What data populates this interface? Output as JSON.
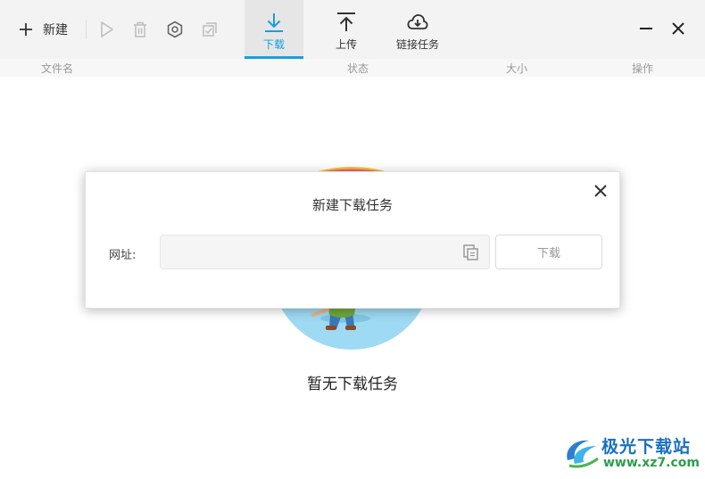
{
  "toolbar": {
    "new_label": "新建",
    "icons": [
      "plus-icon",
      "play-icon",
      "trash-icon",
      "gear-icon",
      "check-square-icon"
    ],
    "tabs": [
      {
        "label": "下载",
        "icon": "download-arrow-icon",
        "active": true
      },
      {
        "label": "上传",
        "icon": "upload-arrow-icon",
        "active": false
      },
      {
        "label": "链接任务",
        "icon": "cloud-download-icon",
        "active": false
      }
    ],
    "accent_color": "#1a9de0"
  },
  "columns": {
    "name": "文件名",
    "status": "状态",
    "size": "大小",
    "action": "操作"
  },
  "empty_state": {
    "text": "暂无下载任务"
  },
  "dialog": {
    "title": "新建下载任务",
    "url_label": "网址:",
    "url_value": "",
    "url_placeholder": "",
    "download_button": "下载"
  },
  "watermark": {
    "title": "极光下载站",
    "url": "www.xz7.com"
  }
}
